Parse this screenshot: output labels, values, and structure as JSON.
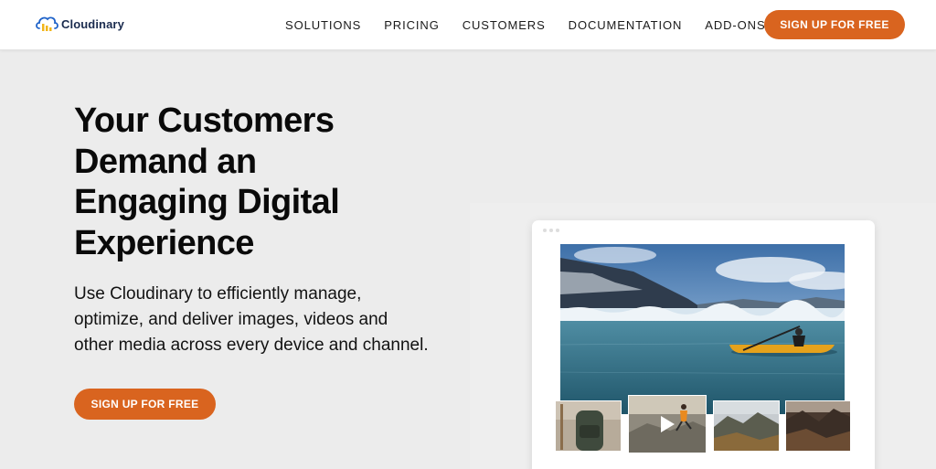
{
  "nav": {
    "brand": "Cloudinary",
    "links": [
      "SOLUTIONS",
      "PRICING",
      "CUSTOMERS",
      "DOCUMENTATION",
      "ADD-ONS"
    ],
    "cta_label": "SIGN UP FOR FREE"
  },
  "hero": {
    "title_lines": [
      "Your Customers",
      "Demand an",
      "Engaging Digital",
      "Experience"
    ],
    "subtitle_lines": [
      "Use Cloudinary to efficiently manage,",
      "optimize, and deliver images, videos and",
      "other media across every device and channel."
    ],
    "cta_label": "SIGN UP FOR FREE"
  },
  "media_card": {
    "main_image": "kayak-glacier-lake-photo",
    "thumbnails": [
      "backpack-photo",
      "hiker-video-thumbnail",
      "mountain-valley-photo",
      "rocky-mountains-photo"
    ],
    "play_icon": "play-icon"
  },
  "colors": {
    "accent": "#d9641f",
    "logo_blue": "#1e62c9",
    "logo_yellow": "#f2b51a",
    "page_bg": "#ececec"
  }
}
